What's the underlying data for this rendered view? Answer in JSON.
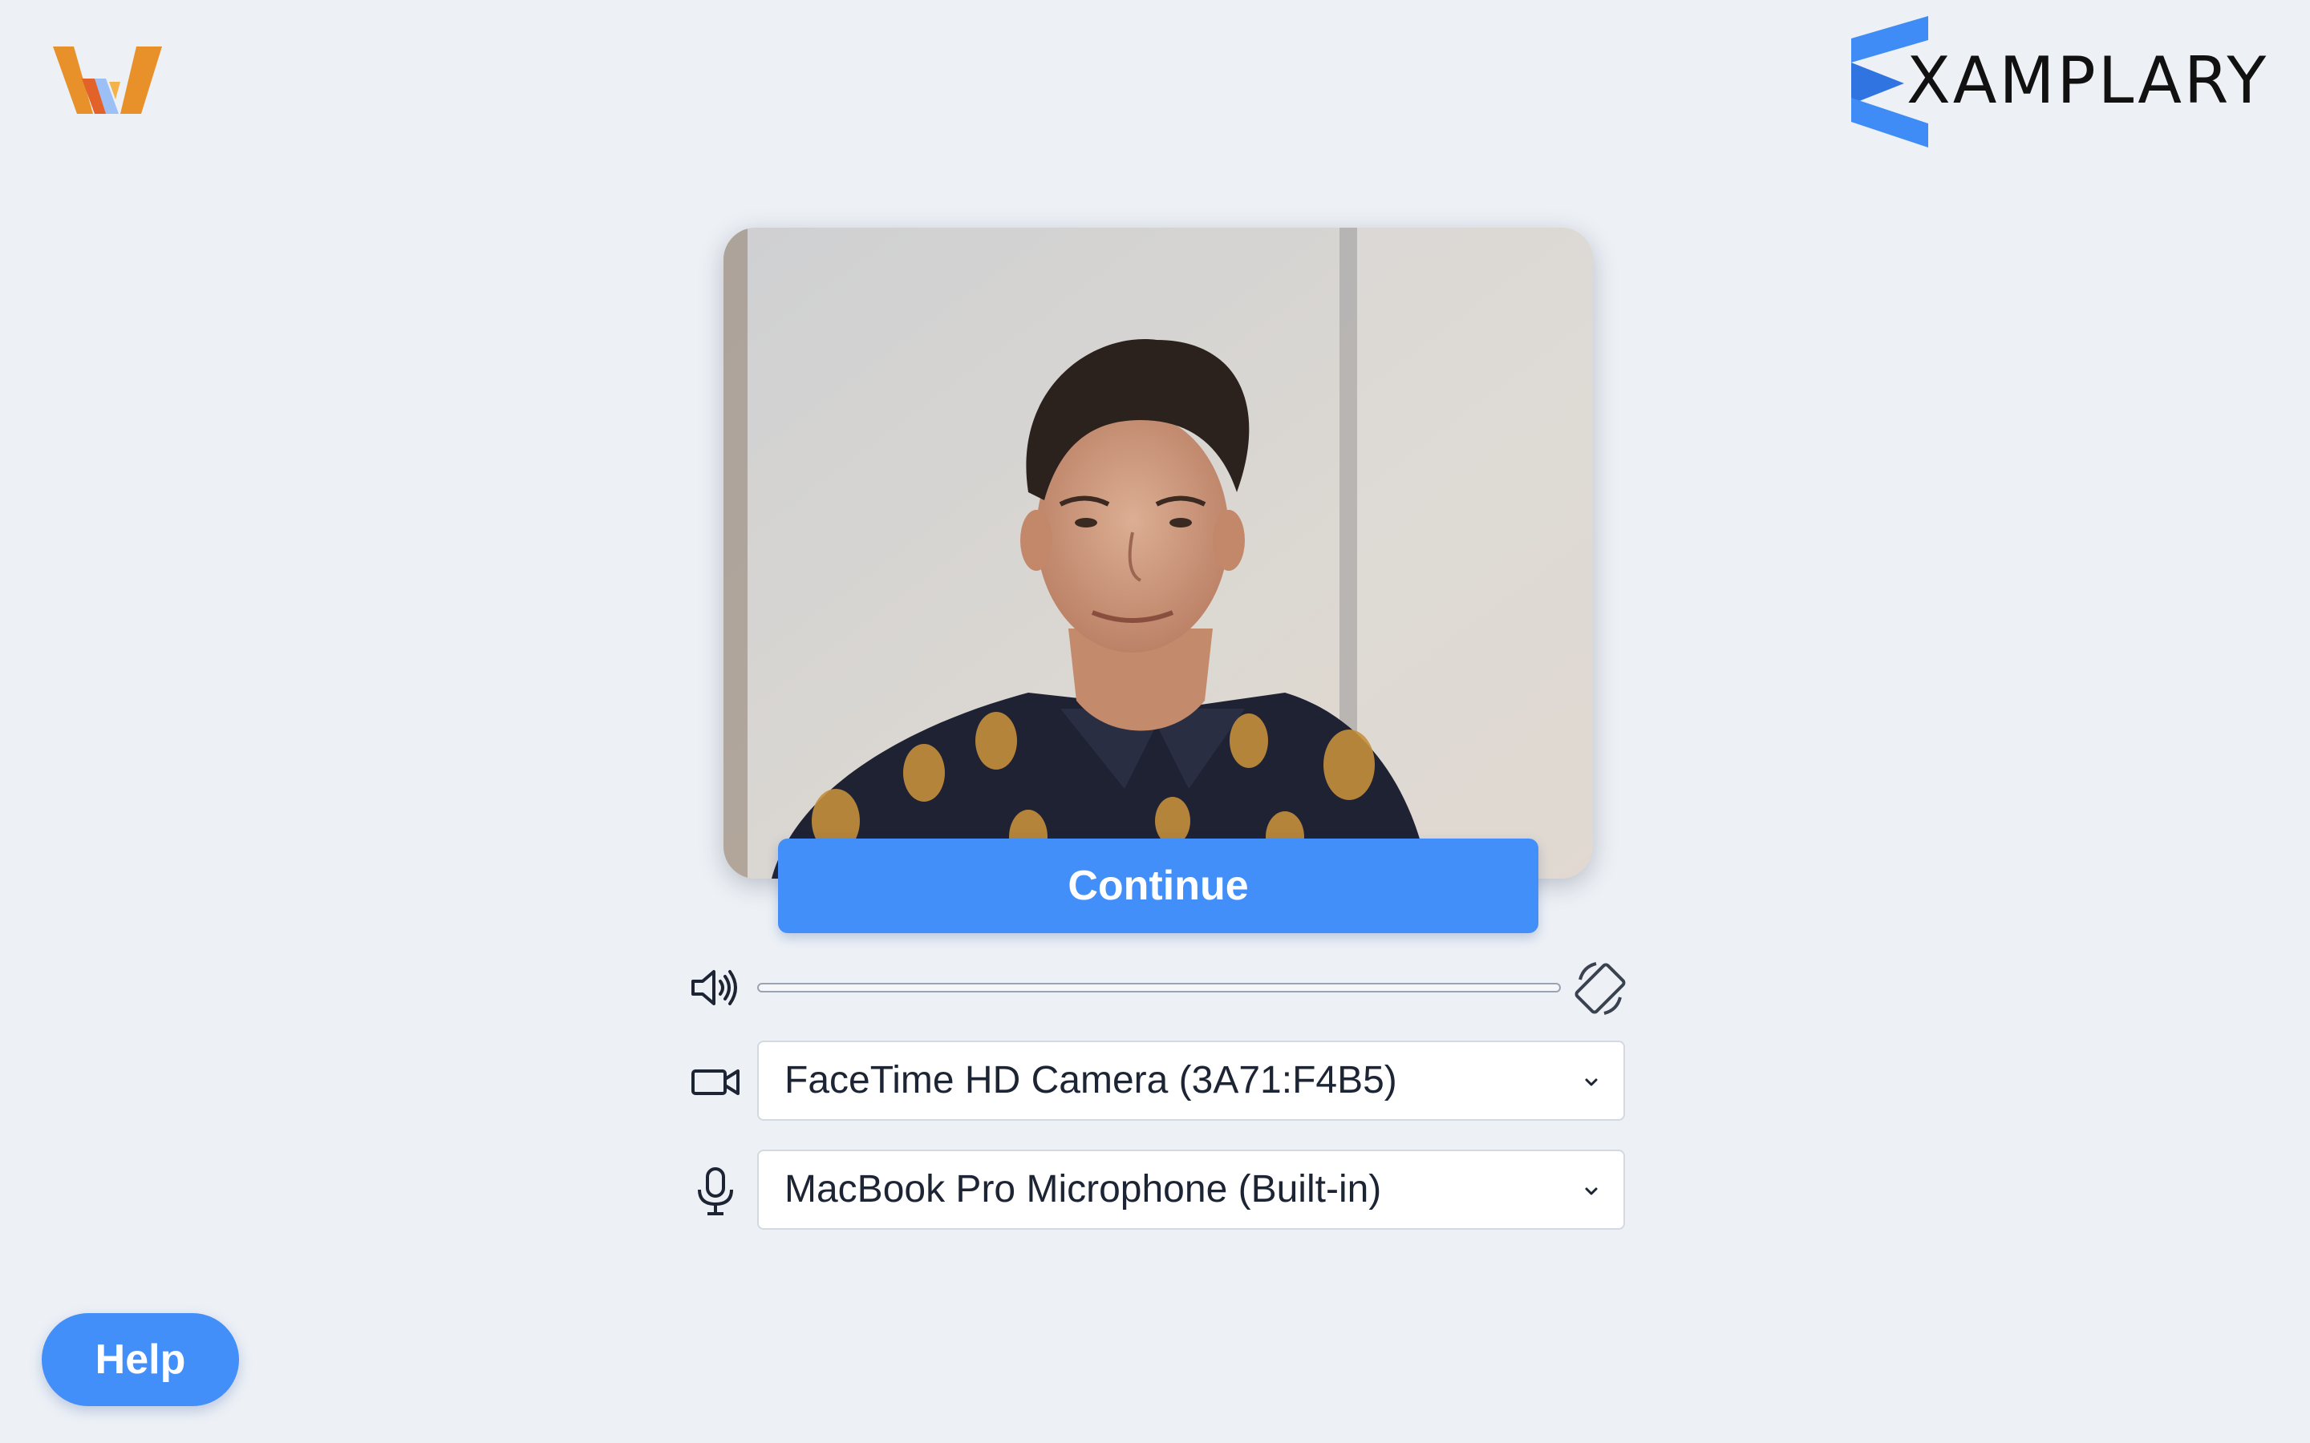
{
  "brand": {
    "left_logo_icon": "w-logo-icon",
    "right_logo_text": "XAMPLARY",
    "right_logo_icon": "examplary-e-icon"
  },
  "video": {
    "icon": "webcam-preview"
  },
  "continue_label": "Continue",
  "controls": {
    "volume_icon": "speaker-icon",
    "rotate_icon": "rotate-icon",
    "volume_level": 0,
    "camera_icon": "video-camera-icon",
    "camera_value": "FaceTime HD Camera (3A71:F4B5)",
    "microphone_icon": "microphone-icon",
    "microphone_value": "MacBook Pro Microphone (Built-in)"
  },
  "help_label": "Help",
  "colors": {
    "accent": "#438ff9",
    "background": "#edf1f6",
    "logo_orange": "#e8912a",
    "logo_blue": "#3f8cf7"
  }
}
